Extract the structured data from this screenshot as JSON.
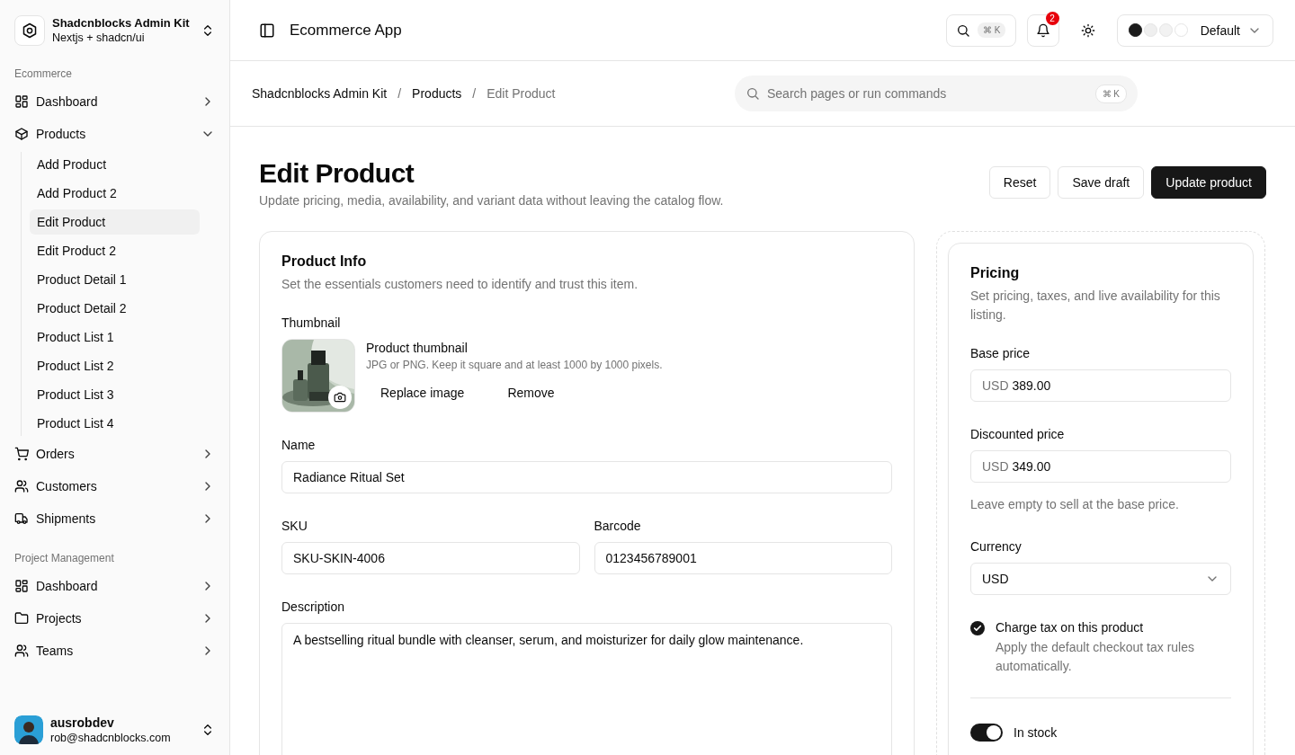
{
  "workspace": {
    "name": "Shadcnblocks Admin Kit",
    "subtitle": "Nextjs + shadcn/ui"
  },
  "sidebar": {
    "groups": [
      {
        "label": "Ecommerce",
        "items": [
          {
            "label": "Dashboard",
            "kind": "grid",
            "expanded": false
          },
          {
            "label": "Products",
            "kind": "box",
            "expanded": true,
            "children": [
              {
                "label": "Add Product",
                "selected": false
              },
              {
                "label": "Add Product 2",
                "selected": false
              },
              {
                "label": "Edit Product",
                "selected": true
              },
              {
                "label": "Edit Product 2",
                "selected": false
              },
              {
                "label": "Product Detail 1",
                "selected": false
              },
              {
                "label": "Product Detail 2",
                "selected": false
              },
              {
                "label": "Product List 1",
                "selected": false
              },
              {
                "label": "Product List 2",
                "selected": false
              },
              {
                "label": "Product List 3",
                "selected": false
              },
              {
                "label": "Product List 4",
                "selected": false
              }
            ]
          },
          {
            "label": "Orders",
            "kind": "cart",
            "expanded": false
          },
          {
            "label": "Customers",
            "kind": "users",
            "expanded": false
          },
          {
            "label": "Shipments",
            "kind": "truck",
            "expanded": false
          }
        ]
      },
      {
        "label": "Project Management",
        "items": [
          {
            "label": "Dashboard",
            "kind": "grid",
            "expanded": false
          },
          {
            "label": "Projects",
            "kind": "folder",
            "expanded": false
          },
          {
            "label": "Teams",
            "kind": "users",
            "expanded": false
          }
        ]
      }
    ]
  },
  "user": {
    "name": "ausrobdev",
    "email": "rob@shadcnblocks.com"
  },
  "header": {
    "title": "Ecommerce App",
    "search_shortcut": "⌘ K",
    "notifications": "2",
    "theme": "Default",
    "swatches": [
      {
        "color": "#1c1c1c"
      },
      {
        "color": "#efefef"
      },
      {
        "color": "#f2f2f2"
      },
      {
        "color": "#ffffff"
      }
    ]
  },
  "breadcrumbs": [
    {
      "kind": "link",
      "label": "Shadcnblocks Admin Kit"
    },
    {
      "kind": "separator",
      "label": "/"
    },
    {
      "kind": "link",
      "label": "Products"
    },
    {
      "kind": "separator",
      "label": "/"
    },
    {
      "kind": "current",
      "label": "Edit Product"
    }
  ],
  "command_search": {
    "placeholder": "Search pages or run commands",
    "shortcut": "⌘ K"
  },
  "page": {
    "title": "Edit Product",
    "subtitle": "Update pricing, media, availability, and variant data without leaving the catalog flow.",
    "buttons": [
      {
        "label": "Reset",
        "kind": "outline"
      },
      {
        "label": "Save draft",
        "kind": "outline"
      },
      {
        "label": "Update product",
        "kind": "primary"
      }
    ]
  },
  "product_info": {
    "title": "Product Info",
    "subtitle": "Set the essentials customers need to identify and trust this item.",
    "thumbnail": {
      "label": "Thumbnail",
      "title": "Product thumbnail",
      "hint": "JPG or PNG. Keep it square and at least 1000 by 1000 pixels.",
      "actions": [
        "Replace image",
        "Remove"
      ]
    },
    "name": {
      "label": "Name",
      "value": "Radiance Ritual Set"
    },
    "sku": {
      "label": "SKU",
      "value": "SKU-SKIN-4006"
    },
    "barcode": {
      "label": "Barcode",
      "value": "0123456789001"
    },
    "description": {
      "label": "Description",
      "value": "A bestselling ritual bundle with cleanser, serum, and moisturizer for daily glow maintenance."
    }
  },
  "pricing": {
    "title": "Pricing",
    "subtitle": "Set pricing, taxes, and live availability for this listing.",
    "base_price": {
      "label": "Base price",
      "prefix": "USD",
      "value": "389.00"
    },
    "discounted_price": {
      "label": "Discounted price",
      "prefix": "USD",
      "value": "349.00",
      "hint": "Leave empty to sell at the base price."
    },
    "currency": {
      "label": "Currency",
      "value": "USD"
    },
    "tax": {
      "label": "Charge tax on this product",
      "description": "Apply the default checkout tax rules automatically.",
      "checked": true
    },
    "in_stock": {
      "label": "In stock",
      "on": true
    }
  }
}
